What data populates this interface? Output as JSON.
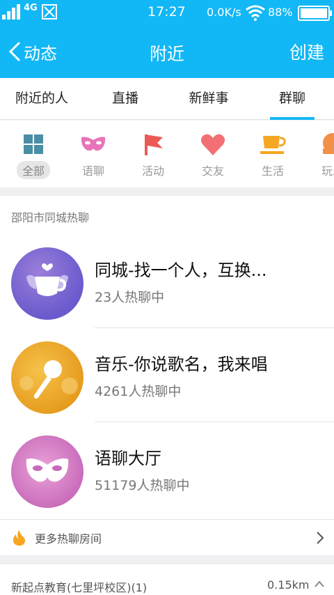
{
  "status_bar": {
    "network": "4G",
    "time": "17:27",
    "speed": "0.0K/s",
    "battery": "88%"
  },
  "header": {
    "back_label": "动态",
    "title": "附近",
    "action_label": "创建"
  },
  "tabs": [
    {
      "label": "附近的人"
    },
    {
      "label": "直播"
    },
    {
      "label": "新鲜事"
    },
    {
      "label": "群聊"
    }
  ],
  "categories": [
    {
      "label": "全部",
      "icon": "grid-icon",
      "color": "#4a8ea5"
    },
    {
      "label": "语聊",
      "icon": "mask-icon",
      "color": "#e873b9"
    },
    {
      "label": "活动",
      "icon": "flag-icon",
      "color": "#ec5a55"
    },
    {
      "label": "交友",
      "icon": "heart-icon",
      "color": "#f27074"
    },
    {
      "label": "生活",
      "icon": "cup-icon",
      "color": "#f5a623"
    },
    {
      "label": "玩乐",
      "icon": "play-icon",
      "color": "#f39047"
    }
  ],
  "section": {
    "title": "邵阳市同城热聊",
    "rooms": [
      {
        "name": "同城-找一个人，互换...",
        "count": "23人热聊中",
        "icon": "coffee-cup-icon"
      },
      {
        "name": "音乐-你说歌名，我来唱",
        "count": "4261人热聊中",
        "icon": "microphone-icon"
      },
      {
        "name": "语聊大厅",
        "count": "51179人热聊中",
        "icon": "mask-icon"
      }
    ],
    "more_label": "更多热聊房间"
  },
  "bottom_item": {
    "label": "新起点教育(七里坪校区)(1)",
    "distance": "0.15km"
  },
  "colors": {
    "accent": "#12b7f5"
  }
}
